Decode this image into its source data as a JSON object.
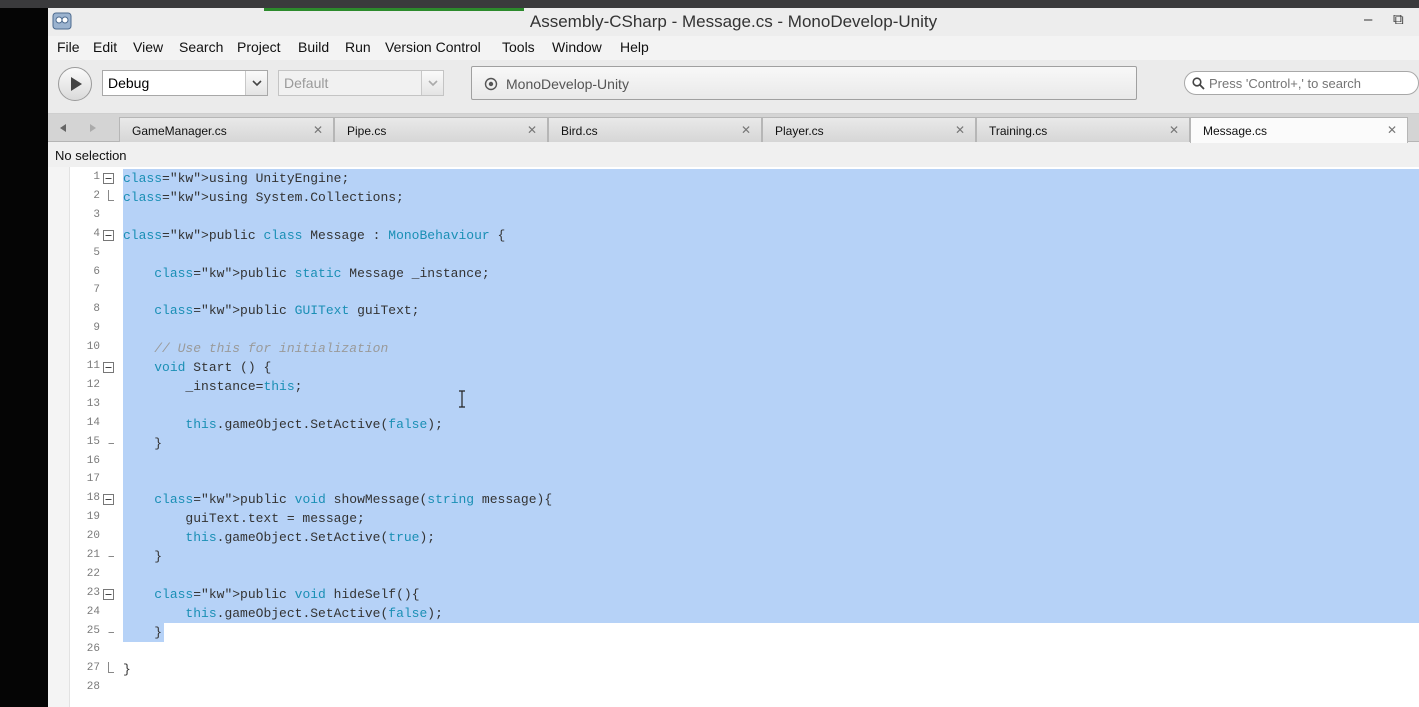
{
  "window": {
    "title": "Assembly-CSharp - Message.cs - MonoDevelop-Unity",
    "minimize": "–",
    "restore": "⧉"
  },
  "menu": [
    "File",
    "Edit",
    "View",
    "Search",
    "Project",
    "Build",
    "Run",
    "Version Control",
    "Tools",
    "Window",
    "Help"
  ],
  "toolbar": {
    "config": "Debug",
    "platform": "Default",
    "status": "MonoDevelop-Unity",
    "search_placeholder": "Press 'Control+,' to search"
  },
  "tabs": [
    {
      "label": "GameManager.cs",
      "active": false
    },
    {
      "label": "Pipe.cs",
      "active": false
    },
    {
      "label": "Bird.cs",
      "active": false
    },
    {
      "label": "Player.cs",
      "active": false
    },
    {
      "label": "Training.cs",
      "active": false
    },
    {
      "label": "Message.cs",
      "active": true
    }
  ],
  "path_bar": "No selection",
  "editor": {
    "selection_color": "#b6d2f7",
    "keyword_color": "#1a8fb5",
    "lines": [
      {
        "n": "1",
        "fold": "open",
        "text": "using UnityEngine;"
      },
      {
        "n": "2",
        "fold": "end",
        "text": "using System.Collections;"
      },
      {
        "n": "3",
        "fold": "",
        "text": ""
      },
      {
        "n": "4",
        "fold": "open",
        "text": "public class Message : MonoBehaviour {"
      },
      {
        "n": "5",
        "fold": "",
        "text": ""
      },
      {
        "n": "6",
        "fold": "",
        "text": "    public static Message _instance;"
      },
      {
        "n": "7",
        "fold": "",
        "text": ""
      },
      {
        "n": "8",
        "fold": "",
        "text": "    public GUIText guiText;"
      },
      {
        "n": "9",
        "fold": "",
        "text": ""
      },
      {
        "n": "10",
        "fold": "",
        "text": "    // Use this for initialization"
      },
      {
        "n": "11",
        "fold": "open",
        "text": "    void Start () {"
      },
      {
        "n": "12",
        "fold": "",
        "text": "        _instance=this;"
      },
      {
        "n": "13",
        "fold": "",
        "text": ""
      },
      {
        "n": "14",
        "fold": "",
        "text": "        this.gameObject.SetActive(false);"
      },
      {
        "n": "15",
        "fold": "close",
        "text": "    }"
      },
      {
        "n": "16",
        "fold": "",
        "text": ""
      },
      {
        "n": "17",
        "fold": "",
        "text": ""
      },
      {
        "n": "18",
        "fold": "open",
        "text": "    public void showMessage(string message){"
      },
      {
        "n": "19",
        "fold": "",
        "text": "        guiText.text = message;"
      },
      {
        "n": "20",
        "fold": "",
        "text": "        this.gameObject.SetActive(true);"
      },
      {
        "n": "21",
        "fold": "close",
        "text": "    }"
      },
      {
        "n": "22",
        "fold": "",
        "text": ""
      },
      {
        "n": "23",
        "fold": "open",
        "text": "    public void hideSelf(){"
      },
      {
        "n": "24",
        "fold": "",
        "text": "        this.gameObject.SetActive(false);"
      },
      {
        "n": "25",
        "fold": "close",
        "text": "    }"
      },
      {
        "n": "26",
        "fold": "",
        "text": ""
      },
      {
        "n": "27",
        "fold": "end",
        "text": "}"
      },
      {
        "n": "28",
        "fold": "",
        "text": ""
      }
    ]
  }
}
